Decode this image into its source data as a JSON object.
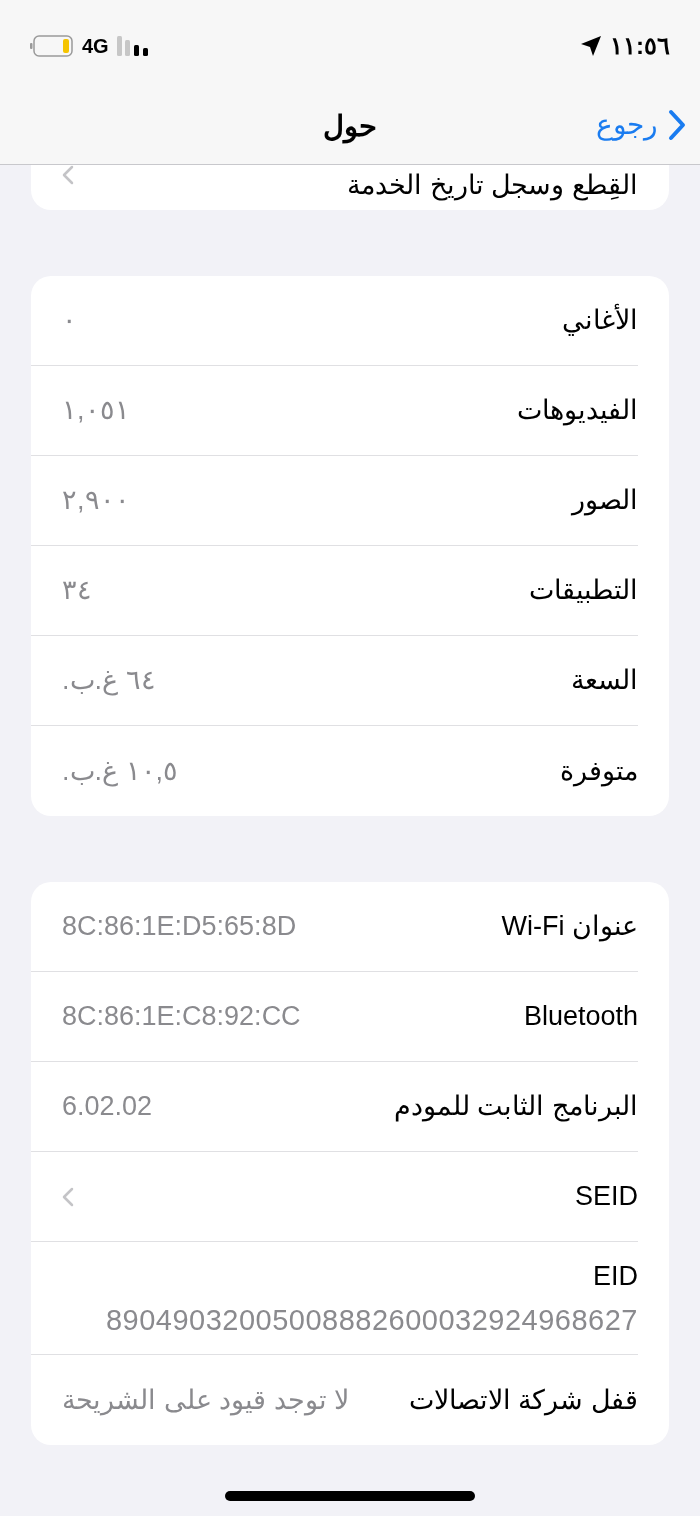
{
  "status_bar": {
    "time": "١١:٥٦",
    "network": "4G"
  },
  "nav_bar": {
    "title": "حول",
    "back_label": "رجوع"
  },
  "sections": [
    {
      "rows": [
        {
          "kind": "chevron",
          "label": "القِطع وسجل تاريخ الخدمة"
        }
      ]
    },
    {
      "rows": [
        {
          "kind": "value",
          "label": "الأغاني",
          "value": "٠"
        },
        {
          "kind": "value",
          "label": "الفيديوهات",
          "value": "١,٠٥١"
        },
        {
          "kind": "value",
          "label": "الصور",
          "value": "٢,٩٠٠"
        },
        {
          "kind": "value",
          "label": "التطبيقات",
          "value": "٣٤"
        },
        {
          "kind": "value",
          "label": "السعة",
          "value": "٦٤ غ.ب."
        },
        {
          "kind": "value",
          "label": "متوفرة",
          "value": "١٠,٥ غ.ب."
        }
      ]
    },
    {
      "rows": [
        {
          "kind": "value",
          "label": "عنوان Wi-Fi",
          "value": "8C:86:1E:D5:65:8D"
        },
        {
          "kind": "value",
          "label": "Bluetooth",
          "value": "8C:86:1E:C8:92:CC"
        },
        {
          "kind": "value",
          "label": "البرنامج الثابت للمودم",
          "value": "6.02.02"
        },
        {
          "kind": "chevron",
          "label": "SEID"
        },
        {
          "kind": "stacked",
          "label": "EID",
          "value": "89049032005008882600032924968627"
        },
        {
          "kind": "value",
          "label": "قفل شركة الاتصالات",
          "value": "لا توجد قيود على الشريحة"
        }
      ]
    }
  ]
}
